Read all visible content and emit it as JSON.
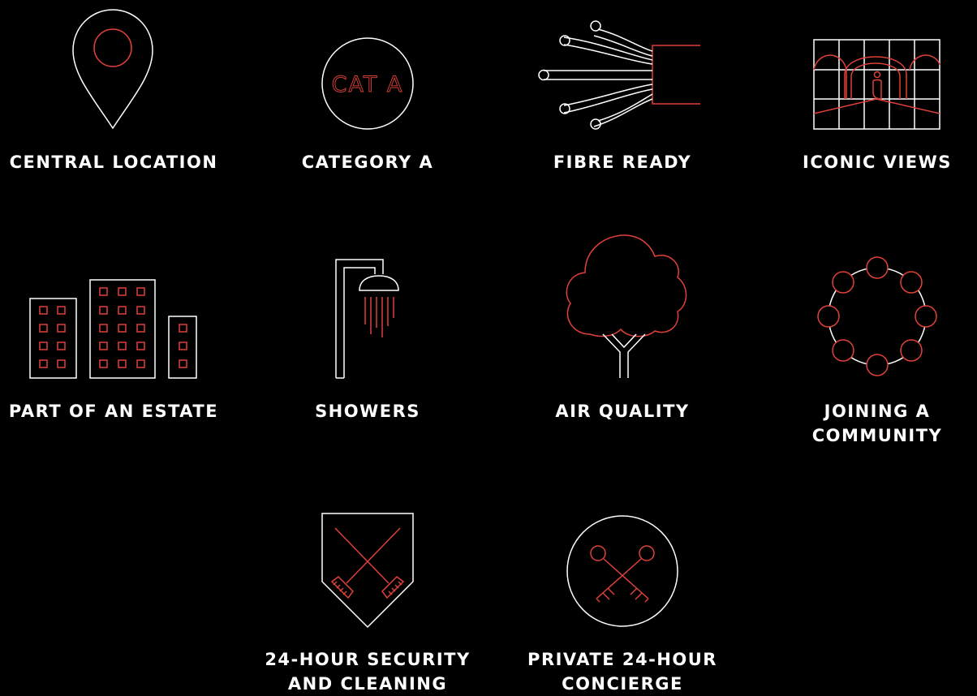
{
  "colors": {
    "background": "#000000",
    "line_white": "#ffffff",
    "accent_red": "#e0413a",
    "label_text": "#ffffff"
  },
  "features": [
    {
      "icon": "location-pin-icon",
      "label": "CENTRAL LOCATION"
    },
    {
      "icon": "cat-a-badge-icon",
      "label": "CATEGORY A",
      "badge_text": "CAT A"
    },
    {
      "icon": "fibre-cable-icon",
      "label": "FIBRE READY"
    },
    {
      "icon": "window-view-icon",
      "label": "ICONIC VIEWS"
    },
    {
      "icon": "buildings-icon",
      "label": "PART OF AN ESTATE"
    },
    {
      "icon": "shower-icon",
      "label": "SHOWERS"
    },
    {
      "icon": "tree-icon",
      "label": "AIR QUALITY"
    },
    {
      "icon": "community-circle-icon",
      "label_lines": [
        "JOINING A",
        "COMMUNITY"
      ]
    },
    {
      "icon": "shield-brooms-icon",
      "label_lines": [
        "24-HOUR SECURITY",
        "AND CLEANING"
      ]
    },
    {
      "icon": "crossed-keys-icon",
      "label_lines": [
        "PRIVATE 24-HOUR",
        "CONCIERGE"
      ]
    }
  ]
}
